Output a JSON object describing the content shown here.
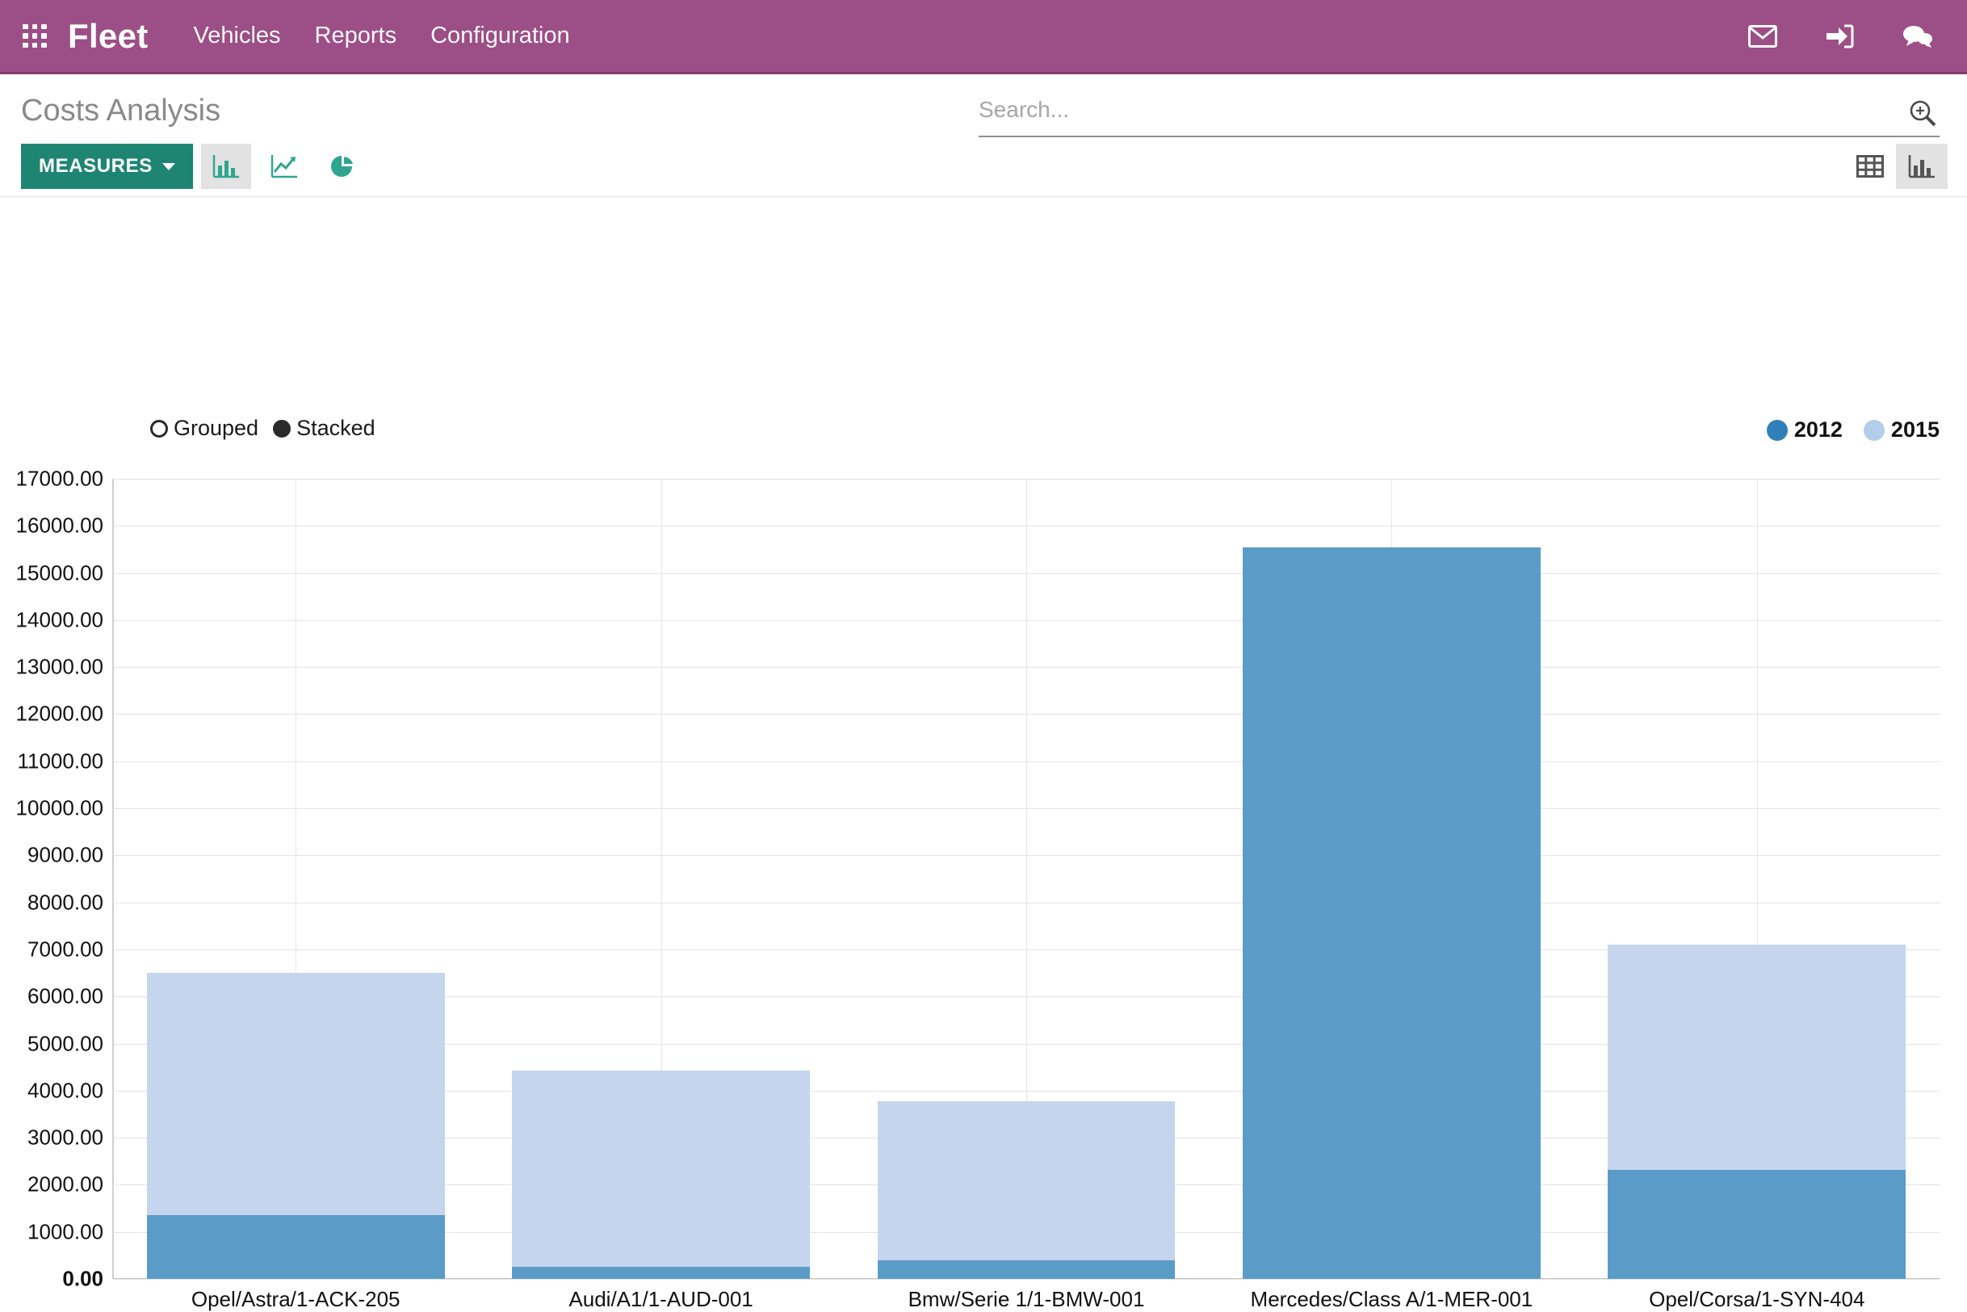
{
  "topbar": {
    "apps_icon": "apps-grid-icon",
    "brand": "Fleet",
    "nav": [
      {
        "label": "Vehicles"
      },
      {
        "label": "Reports"
      },
      {
        "label": "Configuration"
      }
    ],
    "right_icons": [
      {
        "name": "mail-icon"
      },
      {
        "name": "sign-in-icon"
      },
      {
        "name": "chat-icon"
      }
    ],
    "bg_color": "#9C4E86"
  },
  "header": {
    "title": "Costs Analysis"
  },
  "search": {
    "value": "",
    "placeholder": "Search...",
    "icon": "search-plus-icon"
  },
  "toolbar": {
    "measures_label": "MEASURES",
    "chart_types": [
      {
        "name": "bar-chart-icon",
        "active": true
      },
      {
        "name": "line-chart-icon",
        "active": false
      },
      {
        "name": "pie-chart-icon",
        "active": false
      }
    ],
    "accent_color": "#1E8573"
  },
  "view_toggle": [
    {
      "name": "pivot-table-view-icon",
      "active": false
    },
    {
      "name": "graph-view-icon",
      "active": true
    }
  ],
  "stack_options": [
    {
      "label": "Grouped",
      "selected": false
    },
    {
      "label": "Stacked",
      "selected": true
    }
  ],
  "chart_data": {
    "type": "bar",
    "stacked": true,
    "title": "Costs Analysis",
    "xlabel": "",
    "ylabel": "",
    "ylim": [
      0,
      17000
    ],
    "ytick_step": 1000,
    "ytick_labels": [
      "17000.00",
      "16000.00",
      "15000.00",
      "14000.00",
      "13000.00",
      "12000.00",
      "11000.00",
      "10000.00",
      "9000.00",
      "8000.00",
      "7000.00",
      "6000.00",
      "5000.00",
      "4000.00",
      "3000.00",
      "2000.00",
      "1000.00",
      "0.00"
    ],
    "grid": true,
    "legend_position": "top-right",
    "categories": [
      "Opel/Astra/1-ACK-205",
      "Audi/A1/1-AUD-001",
      "Bmw/Serie 1/1-BMW-001",
      "Mercedes/Class A/1-MER-001",
      "Opel/Corsa/1-SYN-404"
    ],
    "series": [
      {
        "name": "2012",
        "color": "#5B9BC8",
        "values": [
          1350,
          250,
          400,
          15550,
          2320
        ]
      },
      {
        "name": "2015",
        "color": "#C4D5ED",
        "values": [
          5150,
          4180,
          3370,
          0,
          4780
        ]
      }
    ],
    "totals": [
      6500,
      4430,
      3770,
      15550,
      7100
    ]
  }
}
